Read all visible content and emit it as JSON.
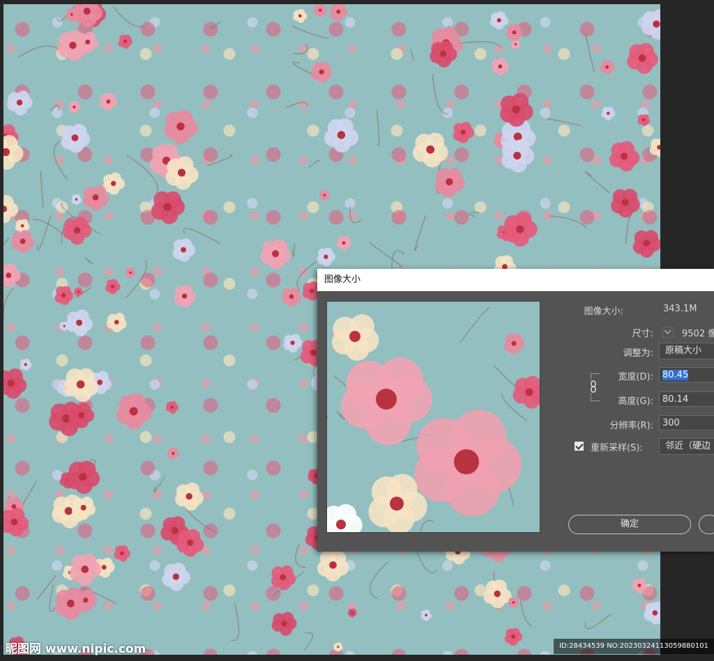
{
  "dialog": {
    "title": "图像大小",
    "image_size_label": "图像大小:",
    "image_size_value": "343.1M",
    "dimensions_label": "尺寸:",
    "dimensions_value": "9502 像",
    "fit_to_label": "调整为:",
    "fit_to_value": "原稿大小",
    "width_label": "宽度(D):",
    "width_value": "80.45",
    "height_label": "高度(G):",
    "height_value": "80.14",
    "resolution_label": "分辨率(R):",
    "resolution_value": "300",
    "resample_label": "重新采样(S):",
    "resample_checked": true,
    "resample_value": "邻近（硬边",
    "ok_label": "确定"
  },
  "watermark": {
    "site": "昵图网 www.nipic.com",
    "id": "ID:28434539 NO:20230324113059880101"
  },
  "colors": {
    "canvas_bg": "#93bfc0",
    "dialog_bg": "#535353",
    "selection": "#2f6fd6",
    "pink": "#e5597a"
  }
}
